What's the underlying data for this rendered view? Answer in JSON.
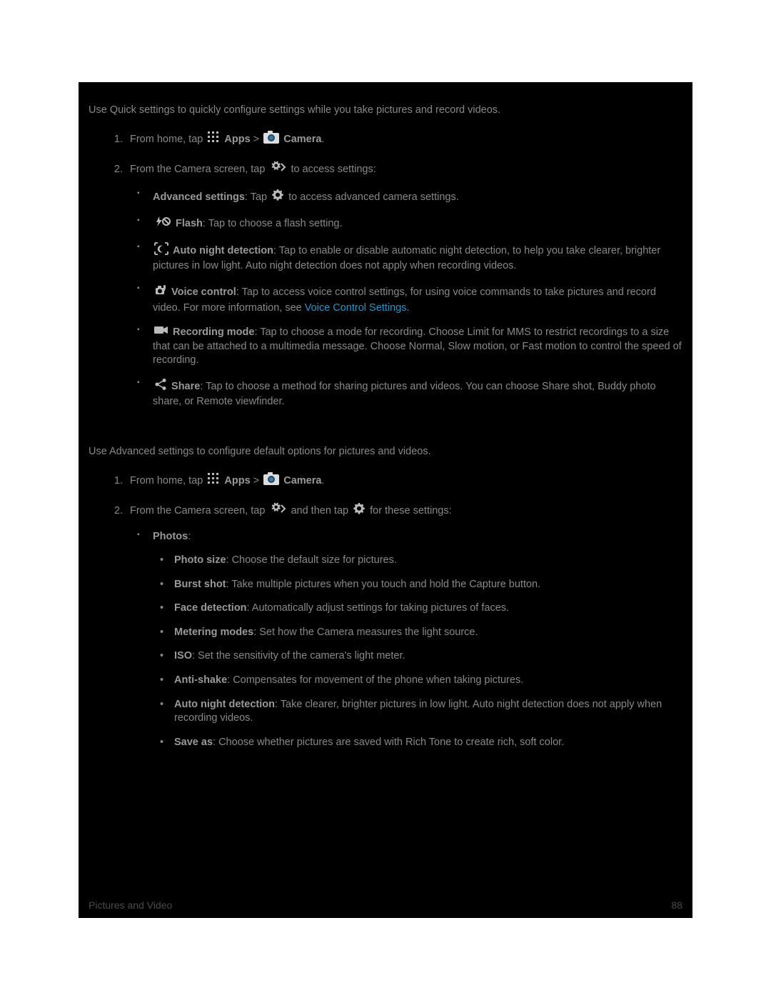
{
  "quick": {
    "intro": "Use Quick settings to quickly configure settings while you take pictures and record videos.",
    "step1_pre": "From home, tap ",
    "apps": "Apps",
    "step1_sep": " > ",
    "camera": "Camera",
    "step1_post": ".",
    "step2_pre": "From the Camera screen, tap ",
    "step2_post": " to access settings:",
    "adv_b": "Advanced settings",
    "adv_mid": ": Tap ",
    "adv_post": " to access advanced camera settings.",
    "flash_b": "Flash",
    "flash_post": ": Tap to choose a flash setting.",
    "night_b": "Auto night detection",
    "night_post": ": Tap to enable or disable automatic night detection, to help you take clearer, brighter pictures in low light. Auto night detection does not apply when recording videos.",
    "voice_b": "Voice control",
    "voice_mid": ": Tap to access voice control settings, for using voice commands to take pictures and record video. For more information, see ",
    "voice_link": "Voice Control Settings",
    "voice_post": ".",
    "rec_b": "Recording mode",
    "rec_post": ": Tap to choose a mode for recording. Choose Limit for MMS to restrict recordings to a size that can be attached to a multimedia message. Choose Normal, Slow motion, or Fast motion to control the speed of recording.",
    "share_b": "Share",
    "share_post": ": Tap to choose a method for sharing pictures and videos. You can choose Share shot, Buddy photo share, or Remote viewfinder."
  },
  "advanced": {
    "intro": "Use Advanced settings to configure default options for pictures and videos.",
    "step1_pre": "From home, tap ",
    "apps": "Apps",
    "step1_sep": " > ",
    "camera": "Camera",
    "step1_post": ".",
    "step2_pre": "From the Camera screen, tap ",
    "step2_mid": " and then tap ",
    "step2_post": " for these settings:",
    "photos_b": "Photos",
    "photos_colon": ":",
    "size_b": "Photo size",
    "size_post": ": Choose the default size for pictures.",
    "burst_b": "Burst shot",
    "burst_post": ": Take multiple pictures when you touch and hold the Capture button.",
    "face_b": "Face detection",
    "face_post": ": Automatically adjust settings for taking pictures of faces.",
    "meter_b": "Metering modes",
    "meter_post": ": Set how the Camera measures the light source.",
    "iso_b": "ISO",
    "iso_post": ": Set the sensitivity of the camera's light meter.",
    "anti_b": "Anti-shake",
    "anti_post": ": Compensates for movement of the phone when taking pictures.",
    "nightd_b": "Auto night detection",
    "nightd_post": ": Take clearer, brighter pictures in low light. Auto night detection does not apply when recording videos.",
    "save_b": "Save as",
    "save_post": ": Choose whether pictures are saved with Rich Tone to create rich, soft color."
  },
  "footer": {
    "left": "Pictures and Video",
    "right": "88"
  }
}
